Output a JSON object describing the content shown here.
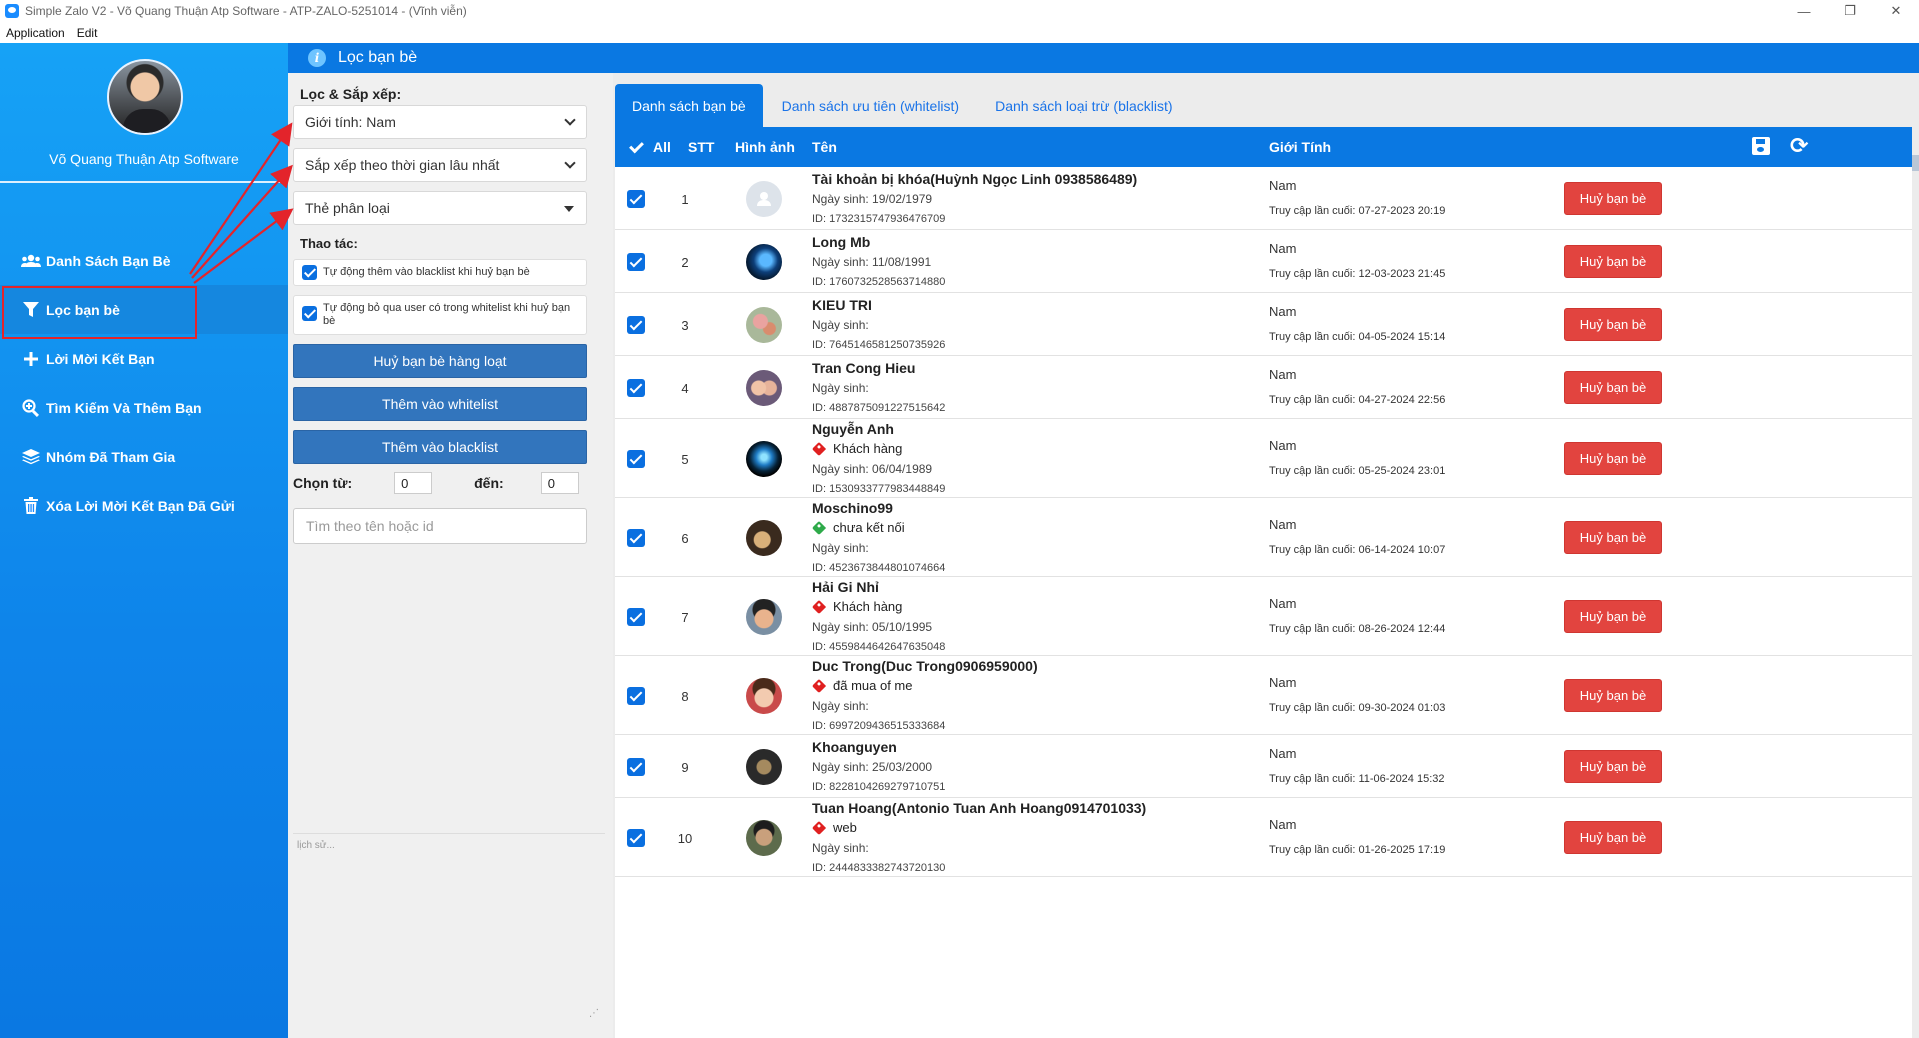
{
  "window": {
    "title": "Simple Zalo V2 - Võ Quang Thuận Atp Software - ATP-ZALO-5251014 - (Vĩnh viễn)",
    "minimize": "—",
    "maximize": "❐",
    "close": "✕"
  },
  "menu": [
    "Application",
    "Edit"
  ],
  "sidebar": {
    "user_name": "Võ Quang Thuận Atp Software",
    "items": [
      {
        "label": "Danh Sách Bạn Bè",
        "icon": "users-icon"
      },
      {
        "label": "Lọc bạn bè",
        "icon": "filter-icon"
      },
      {
        "label": "Lời Mời Kết Bạn",
        "icon": "plus-icon"
      },
      {
        "label": "Tìm Kiếm Và Thêm Bạn",
        "icon": "search-plus-icon"
      },
      {
        "label": "Nhóm Đã Tham Gia",
        "icon": "layers-icon"
      },
      {
        "label": "Xóa Lời Mời Kết Bạn Đã Gửi",
        "icon": "trash-icon"
      }
    ]
  },
  "header": {
    "title": "Lọc bạn bè"
  },
  "filter": {
    "heading": "Lọc & Sắp xếp:",
    "gender_select": "Giới tính: Nam",
    "sort_select": "Sắp xếp theo thời gian lâu nhất",
    "tag_select": "Thẻ phân loại",
    "actions_heading": "Thao tác:",
    "auto_blacklist": "Tự động thêm vào blacklist khi huỷ bạn bè",
    "skip_whitelist": "Tự động bỏ qua user có trong whitelist khi huỷ bạn bè",
    "bulk_unfriend": "Huỷ bạn bè hàng loạt",
    "add_whitelist": "Thêm vào whitelist",
    "add_blacklist": "Thêm vào blacklist",
    "from_label": "Chọn từ:",
    "from_value": "0",
    "to_label": "đến:",
    "to_value": "0",
    "search_placeholder": "Tìm theo tên hoặc id",
    "history_placeholder": "lịch sử..."
  },
  "tabs": [
    "Danh sách bạn bè",
    "Danh sách ưu tiên (whitelist)",
    "Danh sách loại trừ (blacklist)"
  ],
  "table": {
    "headers": {
      "all": "All",
      "stt": "STT",
      "image": "Hình ảnh",
      "name": "Tên",
      "gender": "Giới Tính"
    },
    "unfriend_label": "Huỷ bạn bè",
    "rows": [
      {
        "stt": "1",
        "name": "Tài khoản bị khóa(Huỳnh Ngọc Linh 0938586489)",
        "tag": "",
        "tag_color": "",
        "birth": "Ngày sinh: 19/02/1979",
        "id": "ID: 1732315747936476709",
        "gender": "Nam",
        "last": "Truy cập lần cuối: 07-27-2023 20:19",
        "avatar": "default"
      },
      {
        "stt": "2",
        "name": "Long Mb",
        "tag": "",
        "tag_color": "",
        "birth": "Ngày sinh: 11/08/1991",
        "id": "ID: 1760732528563714880",
        "gender": "Nam",
        "last": "Truy cập lần cuối: 12-03-2023 21:45",
        "avatar": "blue"
      },
      {
        "stt": "3",
        "name": "KIEU TRI",
        "tag": "",
        "tag_color": "",
        "birth": "Ngày sinh:",
        "id": "ID: 7645146581250735926",
        "gender": "Nam",
        "last": "Truy cập lần cuối: 04-05-2024 15:14",
        "avatar": "flowers"
      },
      {
        "stt": "4",
        "name": "Tran Cong Hieu",
        "tag": "",
        "tag_color": "",
        "birth": "Ngày sinh:",
        "id": "ID: 4887875091227515642",
        "gender": "Nam",
        "last": "Truy cập lần cuối: 04-27-2024 22:56",
        "avatar": "couple"
      },
      {
        "stt": "5",
        "name": "Nguyễn Anh",
        "tag": "Khách hàng",
        "tag_color": "#e02020",
        "birth": "Ngày sinh: 06/04/1989",
        "id": "ID: 1530933777983448849",
        "gender": "Nam",
        "last": "Truy cập lần cuối: 05-25-2024 23:01",
        "avatar": "orb"
      },
      {
        "stt": "6",
        "name": "Moschino99",
        "tag": "chưa kết nối",
        "tag_color": "#2eaa4a",
        "birth": "Ngày sinh:",
        "id": "ID: 4523673844801074664",
        "gender": "Nam",
        "last": "Truy cập lần cuối: 06-14-2024 10:07",
        "avatar": "brown"
      },
      {
        "stt": "7",
        "name": "Hải Gi Nhỉ",
        "tag": "Khách hàng",
        "tag_color": "#e02020",
        "birth": "Ngày sinh: 05/10/1995",
        "id": "ID: 4559844642647635048",
        "gender": "Nam",
        "last": "Truy cập lần cuối: 08-26-2024 12:44",
        "avatar": "face"
      },
      {
        "stt": "8",
        "name": "Duc Trong(Duc Trong0906959000)",
        "tag": "đã mua of me",
        "tag_color": "#e02020",
        "birth": "Ngày sinh:",
        "id": "ID: 6997209436515333684",
        "gender": "Nam",
        "last": "Truy cập lần cuối: 09-30-2024 01:03",
        "avatar": "child"
      },
      {
        "stt": "9",
        "name": "Khoanguyen",
        "tag": "",
        "tag_color": "",
        "birth": "Ngày sinh: 25/03/2000",
        "id": "ID: 8228104269279710751",
        "gender": "Nam",
        "last": "Truy cập lần cuối: 11-06-2024 15:32",
        "avatar": "dark"
      },
      {
        "stt": "10",
        "name": "Tuan Hoang(Antonio Tuan Anh Hoang0914701033)",
        "tag": "web",
        "tag_color": "#e02020",
        "birth": "Ngày sinh:",
        "id": "ID: 2444833382743720130",
        "gender": "Nam",
        "last": "Truy cập lần cuối: 01-26-2025 17:19",
        "avatar": "man"
      }
    ]
  },
  "colors": {
    "accent": "#0a78e2",
    "danger": "#e2443f",
    "highlight": "#e3242b"
  }
}
